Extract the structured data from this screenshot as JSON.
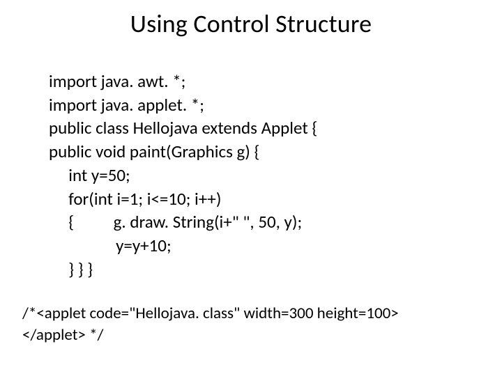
{
  "title": "Using Control Structure",
  "code": {
    "l1": "import java. awt. *;",
    "l2": "import java. applet. *;",
    "l3": "public class Hellojava extends Applet {",
    "l4": "public void paint(Graphics g) {",
    "l5": "     int y=50;",
    "l6": "     for(int i=1; i<=10; i++)",
    "l7": "     {          g. draw. String(i+\" \", 50, y);",
    "l8": "                 y=y+10;",
    "l9": "     } } }"
  },
  "footer": {
    "f1": "/*<applet code=\"Hellojava. class\" width=300 height=100>",
    "f2": "</applet> */"
  }
}
